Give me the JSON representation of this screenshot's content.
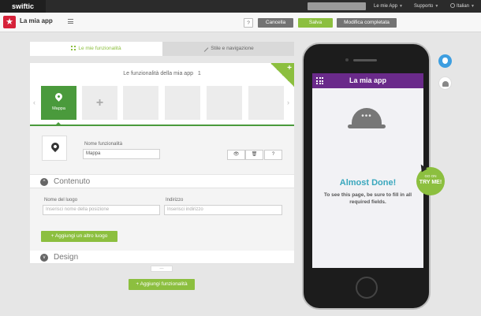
{
  "topbar": {
    "logo": "swiftic",
    "menu_app": "Le mie App",
    "menu_support": "Supporto",
    "menu_language": "Italian"
  },
  "header": {
    "app_name": "La mia app",
    "help_label": "?",
    "cancel_label": "Cancella",
    "save_label": "Salva",
    "complete_label": "Modifica completata"
  },
  "tabs": [
    {
      "label": "Le mie funzionalità",
      "active": true
    },
    {
      "label": "Stile e navigazione",
      "active": false
    }
  ],
  "features_panel": {
    "title": "Le funzionalità della mia app",
    "count": "1",
    "add_corner": "+",
    "arrow_left": "‹",
    "arrow_right": "›",
    "items": [
      {
        "label": "Mappa",
        "type": "map"
      },
      {
        "label": "+",
        "type": "add"
      }
    ]
  },
  "feature_detail": {
    "name_label": "Nome funzionalità",
    "name_value": "Mappa",
    "tool_view": "👁",
    "tool_delete": "🗑",
    "tool_help": "?"
  },
  "content_section": {
    "toggle": "^",
    "title": "Contenuto",
    "place_label": "Nome del luogo",
    "place_placeholder": "Inserisci nome della posizione",
    "address_label": "Indirizzo",
    "address_placeholder": "Inserisci indirizzo",
    "add_place_button": "+ Aggiungi un altro luogo"
  },
  "design_section": {
    "toggle": "v",
    "title": "Design"
  },
  "collapse_tab": "—",
  "add_feature_button": "+ Aggiungi funzionalità",
  "phone_preview": {
    "app_title": "La mia app",
    "heading": "Almost Done!",
    "message": "To see this page, be sure to fill in all required fields.",
    "helmet_dots": "•••",
    "try_me_small": "GO ON",
    "try_me_big": "TRY ME!"
  },
  "colors": {
    "accent_green": "#8cbf3f",
    "dark_green": "#4a9a3c",
    "app_header_purple": "#6a2a8a",
    "heading_teal": "#39a7bd",
    "brand_red": "#d6223a"
  }
}
